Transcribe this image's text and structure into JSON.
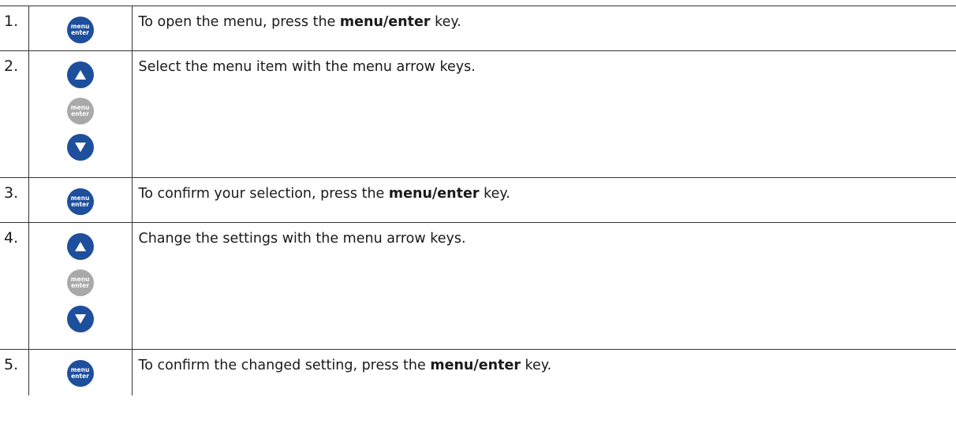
{
  "key_labels": {
    "menu": "menu",
    "enter": "enter"
  },
  "colors": {
    "key_blue": "#1e4f9c",
    "key_gray": "#a9a9a9",
    "border": "#333333"
  },
  "steps": [
    {
      "number": "1.",
      "keys": [
        "menu-enter"
      ],
      "text_before": "To open the menu, press the ",
      "text_bold": "menu/enter",
      "text_after": " key."
    },
    {
      "number": "2.",
      "keys": [
        "up-arrow",
        "menu-enter-inactive",
        "down-arrow"
      ],
      "text_before": "Select the menu item with the menu arrow keys.",
      "text_bold": "",
      "text_after": ""
    },
    {
      "number": "3.",
      "keys": [
        "menu-enter"
      ],
      "text_before": "To confirm your selection, press the ",
      "text_bold": "menu/enter",
      "text_after": " key."
    },
    {
      "number": "4.",
      "keys": [
        "up-arrow",
        "menu-enter-inactive",
        "down-arrow"
      ],
      "text_before": "Change the settings with the menu arrow keys.",
      "text_bold": "",
      "text_after": ""
    },
    {
      "number": "5.",
      "keys": [
        "menu-enter"
      ],
      "text_before": "To confirm the changed setting, press the ",
      "text_bold": "menu/enter",
      "text_after": " key."
    }
  ]
}
